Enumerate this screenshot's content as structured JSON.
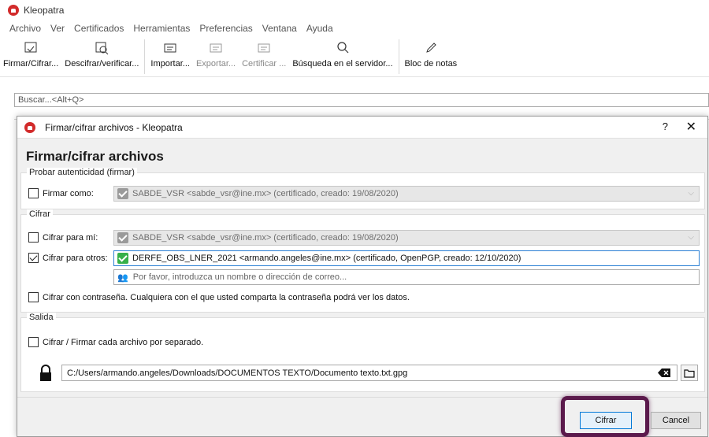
{
  "app": {
    "title": "Kleopatra",
    "brand_color": "#d22b2b"
  },
  "menu": [
    "Archivo",
    "Ver",
    "Certificados",
    "Herramientas",
    "Preferencias",
    "Ventana",
    "Ayuda"
  ],
  "toolbar": {
    "sign_encrypt": "Firmar/Cifrar...",
    "decrypt_verify": "Descifrar/verificar...",
    "import": "Importar...",
    "export": "Exportar...",
    "certify": "Certificar ...",
    "server_search": "Búsqueda en el servidor...",
    "notepad": "Bloc de notas"
  },
  "search": {
    "placeholder": "Buscar...<Alt+Q>"
  },
  "dialog": {
    "window_title": "Firmar/cifrar archivos - Kleopatra",
    "help": "?",
    "close": "✕",
    "heading": "Firmar/cifrar archivos",
    "sign_group": {
      "label": "Probar autenticidad (firmar)",
      "sign_as_label": "Firmar como:",
      "sign_as_checked": false,
      "sign_as_value": "SABDE_VSR <sabde_vsr@ine.mx> (certificado,  creado: 19/08/2020)"
    },
    "encrypt_group": {
      "label": "Cifrar",
      "for_me_label": "Cifrar para mí:",
      "for_me_checked": false,
      "for_me_value": "SABDE_VSR <sabde_vsr@ine.mx> (certificado,  creado: 19/08/2020)",
      "for_others_label": "Cifrar para otros:",
      "for_others_checked": true,
      "for_others_value": "DERFE_OBS_LNER_2021 <armando.angeles@ine.mx> (certificado, OpenPGP, creado: 12/10/2020)",
      "recipient_placeholder": "Por favor, introduzca un nombre o dirección de correo...",
      "password_label": "Cifrar con contraseña. Cualquiera con el que usted comparta la contraseña podrá ver los datos.",
      "password_checked": false
    },
    "output_group": {
      "label": "Salida",
      "separate_label": "Cifrar / Firmar cada archivo por separado.",
      "separate_checked": false,
      "path": "C:/Users/armando.angeles/Downloads/DOCUMENTOS TEXTO/Documento texto.txt.gpg"
    },
    "encrypt_button": "Cifrar",
    "cancel_button": "Cancel",
    "highlight_color": "#5b1a4c"
  }
}
